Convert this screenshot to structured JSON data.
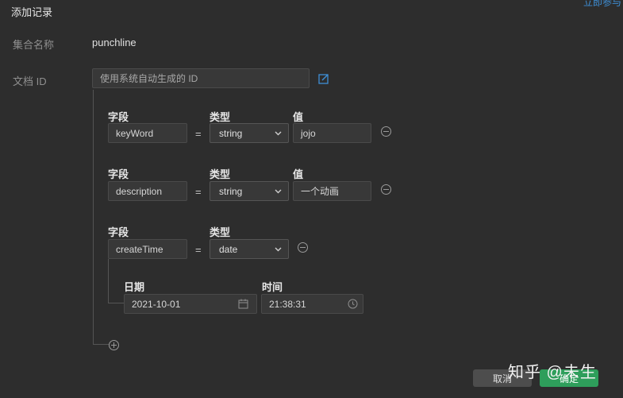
{
  "dialog": {
    "title": "添加记录",
    "top_link": "立即参与",
    "collection_label": "集合名称",
    "collection_value": "punchline",
    "doc_id_label": "文档 ID",
    "doc_id_placeholder": "使用系统自动生成的 ID"
  },
  "fields": [
    {
      "field_header": "字段",
      "type_header": "类型",
      "value_header": "值",
      "name": "keyWord",
      "eq": "=",
      "type": "string",
      "value": "jojo"
    },
    {
      "field_header": "字段",
      "type_header": "类型",
      "value_header": "值",
      "name": "description",
      "eq": "=",
      "type": "string",
      "value": "一个动画"
    },
    {
      "field_header": "字段",
      "type_header": "类型",
      "name": "createTime",
      "eq": "=",
      "type": "date",
      "date_header": "日期",
      "time_header": "时间",
      "date_value": "2021-10-01",
      "time_value": "21:38:31"
    }
  ],
  "buttons": {
    "cancel": "取消",
    "confirm": "确定"
  },
  "watermark": "知乎 @未生",
  "colors": {
    "background": "#2d2d2d",
    "accent": "#3e8fd6",
    "confirm": "#2e9e5b"
  }
}
